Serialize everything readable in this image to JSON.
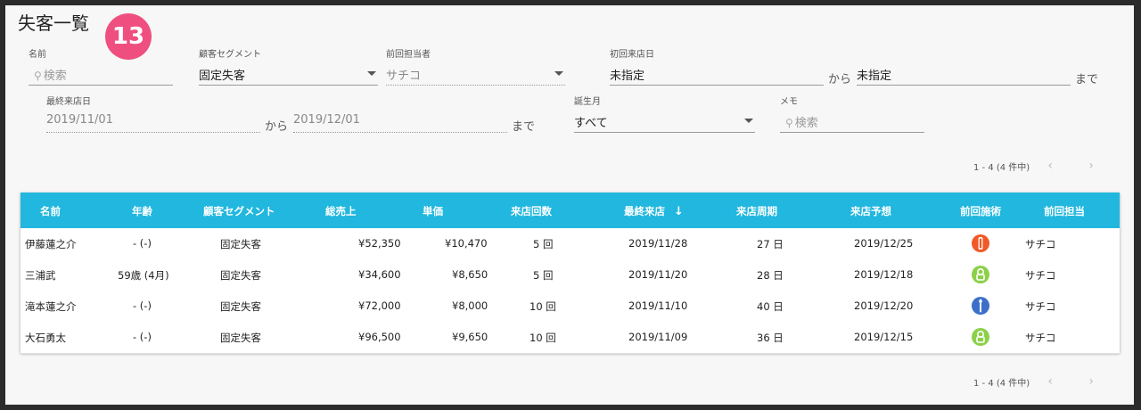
{
  "page": {
    "title": "失客一覧",
    "badge": "13"
  },
  "filters": {
    "name": {
      "label": "名前",
      "placeholder": "検索"
    },
    "segment": {
      "label": "顧客セグメント",
      "value": "固定失客"
    },
    "staff": {
      "label": "前回担当者",
      "value": "サチコ"
    },
    "first_visit": {
      "label": "初回来店日",
      "from": "未指定",
      "to": "未指定",
      "from_suffix": "から",
      "to_suffix": "まで"
    },
    "last_visit": {
      "label": "最終来店日",
      "from": "2019/11/01",
      "to": "2019/12/01",
      "from_suffix": "から",
      "to_suffix": "まで"
    },
    "birth_month": {
      "label": "誕生月",
      "value": "すべて"
    },
    "memo": {
      "label": "メモ",
      "placeholder": "検索"
    }
  },
  "pagination": {
    "text": "1 - 4 (4 件中)",
    "prev": "‹",
    "next": "›"
  },
  "table": {
    "headers": [
      "名前",
      "年齢",
      "顧客セグメント",
      "総売上",
      "単価",
      "来店回数",
      "最終来店",
      "来店周期",
      "来店予想",
      "前回施術",
      "前回担当"
    ],
    "sort_arrow": "↓",
    "rows": [
      {
        "name": "伊藤蓮之介",
        "age": "- (-)",
        "segment": "固定失客",
        "total": "¥52,350",
        "unit": "¥10,470",
        "visits": "5 回",
        "last": "2019/11/28",
        "cycle": "27 日",
        "forecast": "2019/12/25",
        "treatment_icon": "orange-treatment-icon",
        "staff": "サチコ"
      },
      {
        "name": "三浦武",
        "age": "59歳 (4月)",
        "segment": "固定失客",
        "total": "¥34,600",
        "unit": "¥8,650",
        "visits": "5 回",
        "last": "2019/11/20",
        "cycle": "28 日",
        "forecast": "2019/12/18",
        "treatment_icon": "green-treatment-icon",
        "staff": "サチコ"
      },
      {
        "name": "滝本蓮之介",
        "age": "- (-)",
        "segment": "固定失客",
        "total": "¥72,000",
        "unit": "¥8,000",
        "visits": "10 回",
        "last": "2019/11/10",
        "cycle": "40 日",
        "forecast": "2019/12/20",
        "treatment_icon": "blue-treatment-icon",
        "staff": "サチコ"
      },
      {
        "name": "大石勇太",
        "age": "- (-)",
        "segment": "固定失客",
        "total": "¥96,500",
        "unit": "¥9,650",
        "visits": "10 回",
        "last": "2019/11/09",
        "cycle": "36 日",
        "forecast": "2019/12/15",
        "treatment_icon": "green-treatment-icon",
        "staff": "サチコ"
      }
    ]
  },
  "colors": {
    "header": "#21b7de",
    "badge": "#ef4f7f",
    "orange": "#f05a28",
    "green": "#8cd04a",
    "blue": "#3b6fc9"
  }
}
